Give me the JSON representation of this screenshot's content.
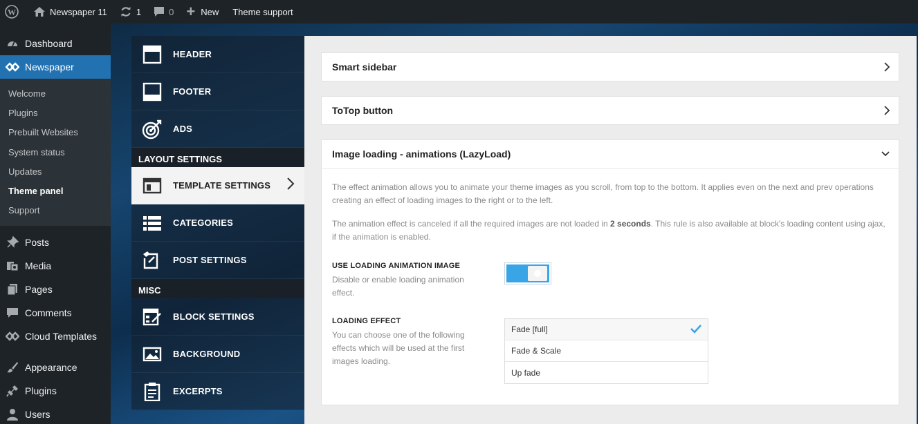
{
  "adminbar": {
    "site_name": "Newspaper 11",
    "updates_count": "1",
    "comments_count": "0",
    "new_label": "New",
    "support_label": "Theme support"
  },
  "wpmenu": {
    "dashboard": "Dashboard",
    "newspaper": "Newspaper",
    "submenu": [
      "Welcome",
      "Plugins",
      "Prebuilt Websites",
      "System status",
      "Updates",
      "Theme panel",
      "Support"
    ],
    "posts": "Posts",
    "media": "Media",
    "pages": "Pages",
    "comments": "Comments",
    "cloud_templates": "Cloud Templates",
    "appearance": "Appearance",
    "plugins": "Plugins",
    "users": "Users"
  },
  "theme_nav": {
    "header": "HEADER",
    "footer": "FOOTER",
    "ads": "ADS",
    "section_layout": "LAYOUT SETTINGS",
    "template_settings": "TEMPLATE SETTINGS",
    "categories": "CATEGORIES",
    "post_settings": "POST SETTINGS",
    "section_misc": "MISC",
    "block_settings": "BLOCK SETTINGS",
    "background": "BACKGROUND",
    "excerpts": "EXCERPTS"
  },
  "content": {
    "box1_title": "Smart sidebar",
    "box2_title": "ToTop button",
    "box3_title": "Image loading - animations (LazyLoad)",
    "desc1": "The effect animation allows you to animate your theme images as you scroll, from top to the bottom. It applies even on the next and prev operations creating an effect of loading images to the right or to the left.",
    "desc2_pre": "The animation effect is canceled if all the required images are not loaded in ",
    "desc2_bold": "2 seconds",
    "desc2_post": ". This rule is also available at block's loading content using ajax, if the animation is enabled.",
    "opt1_title": "USE LOADING ANIMATION IMAGE",
    "opt1_desc": "Disable or enable loading animation effect.",
    "opt1_enabled": true,
    "opt2_title": "LOADING EFFECT",
    "opt2_desc": "You can choose one of the following effects which will be used at the first images loading.",
    "effects": [
      "Fade [full]",
      "Fade & Scale",
      "Up fade"
    ],
    "selected_effect": "Fade [full]"
  },
  "colors": {
    "wp_accent": "#2271b1",
    "toggle_on": "#3aa5e6",
    "check": "#3aa5e6"
  }
}
